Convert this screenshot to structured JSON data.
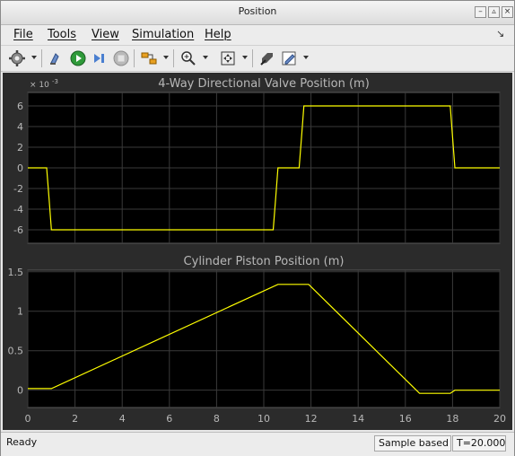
{
  "window": {
    "title": "Position"
  },
  "menu": {
    "items": [
      "File",
      "Tools",
      "View",
      "Simulation",
      "Help"
    ]
  },
  "toolbar": {
    "icons": [
      "gear-icon",
      "highlight-icon",
      "run-icon",
      "step-forward-icon",
      "stop-icon",
      "signal-selector-icon",
      "zoom-in-icon",
      "autoscale-icon",
      "dock-icon",
      "edit-icon"
    ]
  },
  "colors": {
    "axes_background": "#000000",
    "figure_background": "#2b2b2b",
    "line": "#ffff00",
    "grid": "#3a3a3a",
    "text": "#b8b8b8"
  },
  "chart_data": [
    {
      "type": "line",
      "title": "4-Way Directional Valve Position (m)",
      "exponent_label": "× 10",
      "exponent": "-3",
      "xlim": [
        0,
        20
      ],
      "ylim": [
        -7.3,
        7.3
      ],
      "yticks": [
        "6",
        "4",
        "2",
        "0",
        "-2",
        "-4",
        "-6"
      ],
      "ytick_values": [
        6,
        4,
        2,
        0,
        -2,
        -4,
        -6
      ],
      "grid": true,
      "series": [
        {
          "x": [
            0,
            0.8,
            0.9,
            1.0,
            10.4,
            10.5,
            10.6,
            11.5,
            11.6,
            11.7,
            17.9,
            18.0,
            18.1,
            20
          ],
          "y": [
            0,
            0,
            -3,
            -6,
            -6,
            -3,
            0,
            0,
            3,
            6,
            6,
            3,
            0,
            0
          ]
        }
      ]
    },
    {
      "type": "line",
      "title": "Cylinder Piston Position (m)",
      "xlim": [
        0,
        20
      ],
      "ylim": [
        -0.22,
        1.52
      ],
      "xticks": [
        "0",
        "2",
        "4",
        "6",
        "8",
        "10",
        "12",
        "14",
        "16",
        "18",
        "20"
      ],
      "xtick_values": [
        0,
        2,
        4,
        6,
        8,
        10,
        12,
        14,
        16,
        18,
        20
      ],
      "yticks": [
        "1.5",
        "1",
        "0.5",
        "0"
      ],
      "ytick_values": [
        1.5,
        1,
        0.5,
        0
      ],
      "grid": true,
      "series": [
        {
          "x": [
            0,
            1.0,
            10.6,
            11.9,
            16.6,
            17.9,
            18.1,
            20
          ],
          "y": [
            0.02,
            0.02,
            1.34,
            1.34,
            -0.04,
            -0.04,
            0,
            0
          ]
        }
      ]
    }
  ],
  "status": {
    "state": "Ready",
    "mode": "Sample based",
    "time": "T=20.000"
  }
}
